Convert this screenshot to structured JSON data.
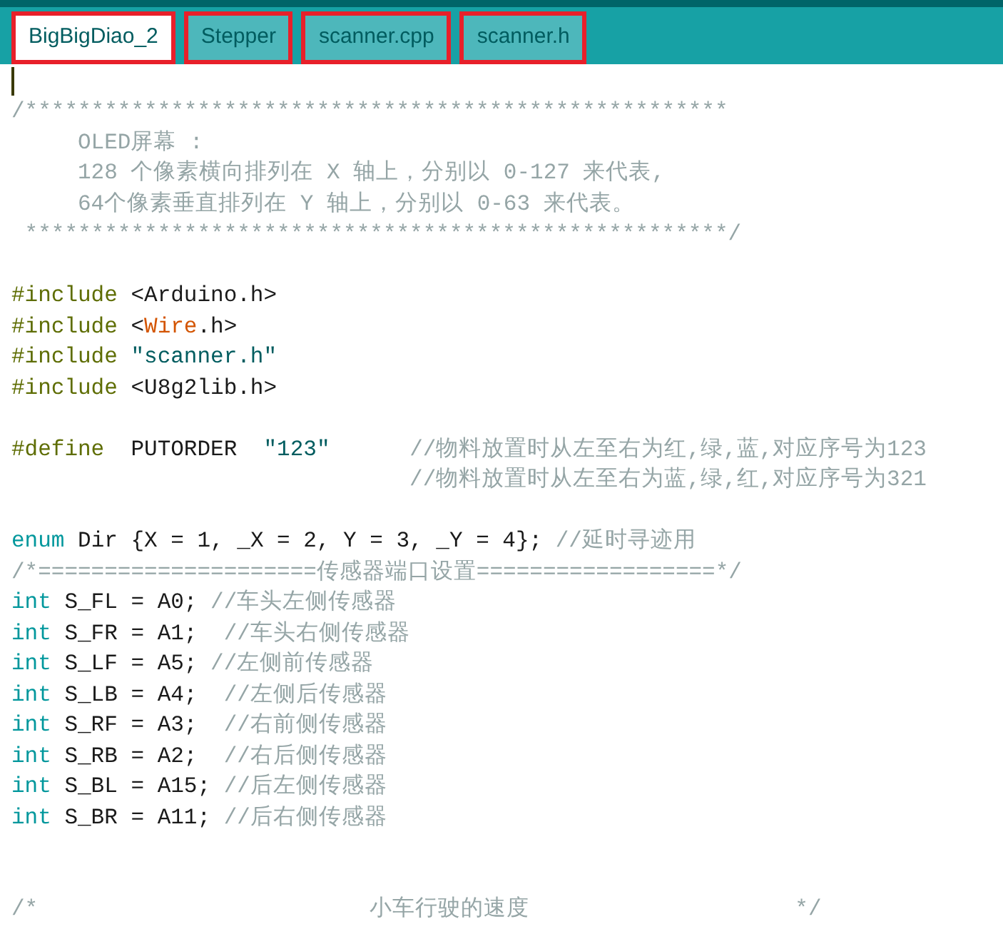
{
  "tabs": [
    {
      "label": "BigBigDiao_2",
      "selected": true,
      "highlighted": true
    },
    {
      "label": "Stepper",
      "selected": false,
      "highlighted": true
    },
    {
      "label": "scanner.cpp",
      "selected": false,
      "highlighted": true
    },
    {
      "label": "scanner.h",
      "selected": false,
      "highlighted": true
    }
  ],
  "editor": {
    "lines": [
      {
        "kind": "cursor"
      },
      {
        "kind": "code",
        "tokens": [
          {
            "kind": "comment",
            "text": "/*****************************************************"
          }
        ]
      },
      {
        "kind": "code",
        "tokens": [
          {
            "kind": "comment",
            "text": "     OLED屏幕 :"
          }
        ]
      },
      {
        "kind": "code",
        "tokens": [
          {
            "kind": "comment",
            "text": "     128 个像素横向排列在 X 轴上，分别以 0-127 来代表,"
          }
        ]
      },
      {
        "kind": "code",
        "tokens": [
          {
            "kind": "comment",
            "text": "     64个像素垂直排列在 Y 轴上，分别以 0-63 来代表。"
          }
        ]
      },
      {
        "kind": "code",
        "tokens": [
          {
            "kind": "comment",
            "text": " *****************************************************/"
          }
        ]
      },
      {
        "kind": "blank"
      },
      {
        "kind": "code",
        "tokens": [
          {
            "kind": "preprocessor",
            "text": "#include"
          },
          {
            "kind": "plain",
            "text": " <Arduino.h>"
          }
        ]
      },
      {
        "kind": "code",
        "tokens": [
          {
            "kind": "preprocessor",
            "text": "#include"
          },
          {
            "kind": "plain",
            "text": " <"
          },
          {
            "kind": "library",
            "text": "Wire"
          },
          {
            "kind": "plain",
            "text": ".h>"
          }
        ]
      },
      {
        "kind": "code",
        "tokens": [
          {
            "kind": "preprocessor",
            "text": "#include"
          },
          {
            "kind": "string",
            "text": " \"scanner.h\""
          }
        ]
      },
      {
        "kind": "code",
        "tokens": [
          {
            "kind": "preprocessor",
            "text": "#include"
          },
          {
            "kind": "plain",
            "text": " <U8g2lib.h>"
          }
        ]
      },
      {
        "kind": "blank"
      },
      {
        "kind": "code",
        "tokens": [
          {
            "kind": "preprocessor",
            "text": "#define"
          },
          {
            "kind": "plain",
            "text": "  PUTORDER  "
          },
          {
            "kind": "string",
            "text": "\"123\""
          },
          {
            "kind": "comment",
            "text": "      //物料放置时从左至右为红,绿,蓝,对应序号为123"
          }
        ]
      },
      {
        "kind": "code",
        "tokens": [
          {
            "kind": "comment",
            "text": "                              //物料放置时从左至右为蓝,绿,红,对应序号为321"
          }
        ]
      },
      {
        "kind": "blank"
      },
      {
        "kind": "code",
        "tokens": [
          {
            "kind": "type",
            "text": "enum"
          },
          {
            "kind": "plain",
            "text": " Dir {X = 1, _X = 2, Y = 3, _Y = 4}; "
          },
          {
            "kind": "comment",
            "text": "//延时寻迹用"
          }
        ]
      },
      {
        "kind": "code",
        "tokens": [
          {
            "kind": "comment",
            "text": "/*=====================传感器端口设置==================*/"
          }
        ]
      },
      {
        "kind": "code",
        "tokens": [
          {
            "kind": "type",
            "text": "int"
          },
          {
            "kind": "plain",
            "text": " S_FL = A0; "
          },
          {
            "kind": "comment",
            "text": "//车头左侧传感器"
          }
        ]
      },
      {
        "kind": "code",
        "tokens": [
          {
            "kind": "type",
            "text": "int"
          },
          {
            "kind": "plain",
            "text": " S_FR = A1;  "
          },
          {
            "kind": "comment",
            "text": "//车头右侧传感器"
          }
        ]
      },
      {
        "kind": "code",
        "tokens": [
          {
            "kind": "type",
            "text": "int"
          },
          {
            "kind": "plain",
            "text": " S_LF = A5; "
          },
          {
            "kind": "comment",
            "text": "//左侧前传感器"
          }
        ]
      },
      {
        "kind": "code",
        "tokens": [
          {
            "kind": "type",
            "text": "int"
          },
          {
            "kind": "plain",
            "text": " S_LB = A4;  "
          },
          {
            "kind": "comment",
            "text": "//左侧后传感器"
          }
        ]
      },
      {
        "kind": "code",
        "tokens": [
          {
            "kind": "type",
            "text": "int"
          },
          {
            "kind": "plain",
            "text": " S_RF = A3;  "
          },
          {
            "kind": "comment",
            "text": "//右前侧传感器"
          }
        ]
      },
      {
        "kind": "code",
        "tokens": [
          {
            "kind": "type",
            "text": "int"
          },
          {
            "kind": "plain",
            "text": " S_RB = A2;  "
          },
          {
            "kind": "comment",
            "text": "//右后侧传感器"
          }
        ]
      },
      {
        "kind": "code",
        "tokens": [
          {
            "kind": "type",
            "text": "int"
          },
          {
            "kind": "plain",
            "text": " S_BL = A15; "
          },
          {
            "kind": "comment",
            "text": "//后左侧传感器"
          }
        ]
      },
      {
        "kind": "code",
        "tokens": [
          {
            "kind": "type",
            "text": "int"
          },
          {
            "kind": "plain",
            "text": " S_BR = A11; "
          },
          {
            "kind": "comment",
            "text": "//后右侧传感器"
          }
        ]
      },
      {
        "kind": "blank"
      },
      {
        "kind": "blank"
      },
      {
        "kind": "code",
        "tokens": [
          {
            "kind": "comment",
            "text": "/*                         小车行驶的速度                    */"
          }
        ]
      }
    ]
  }
}
